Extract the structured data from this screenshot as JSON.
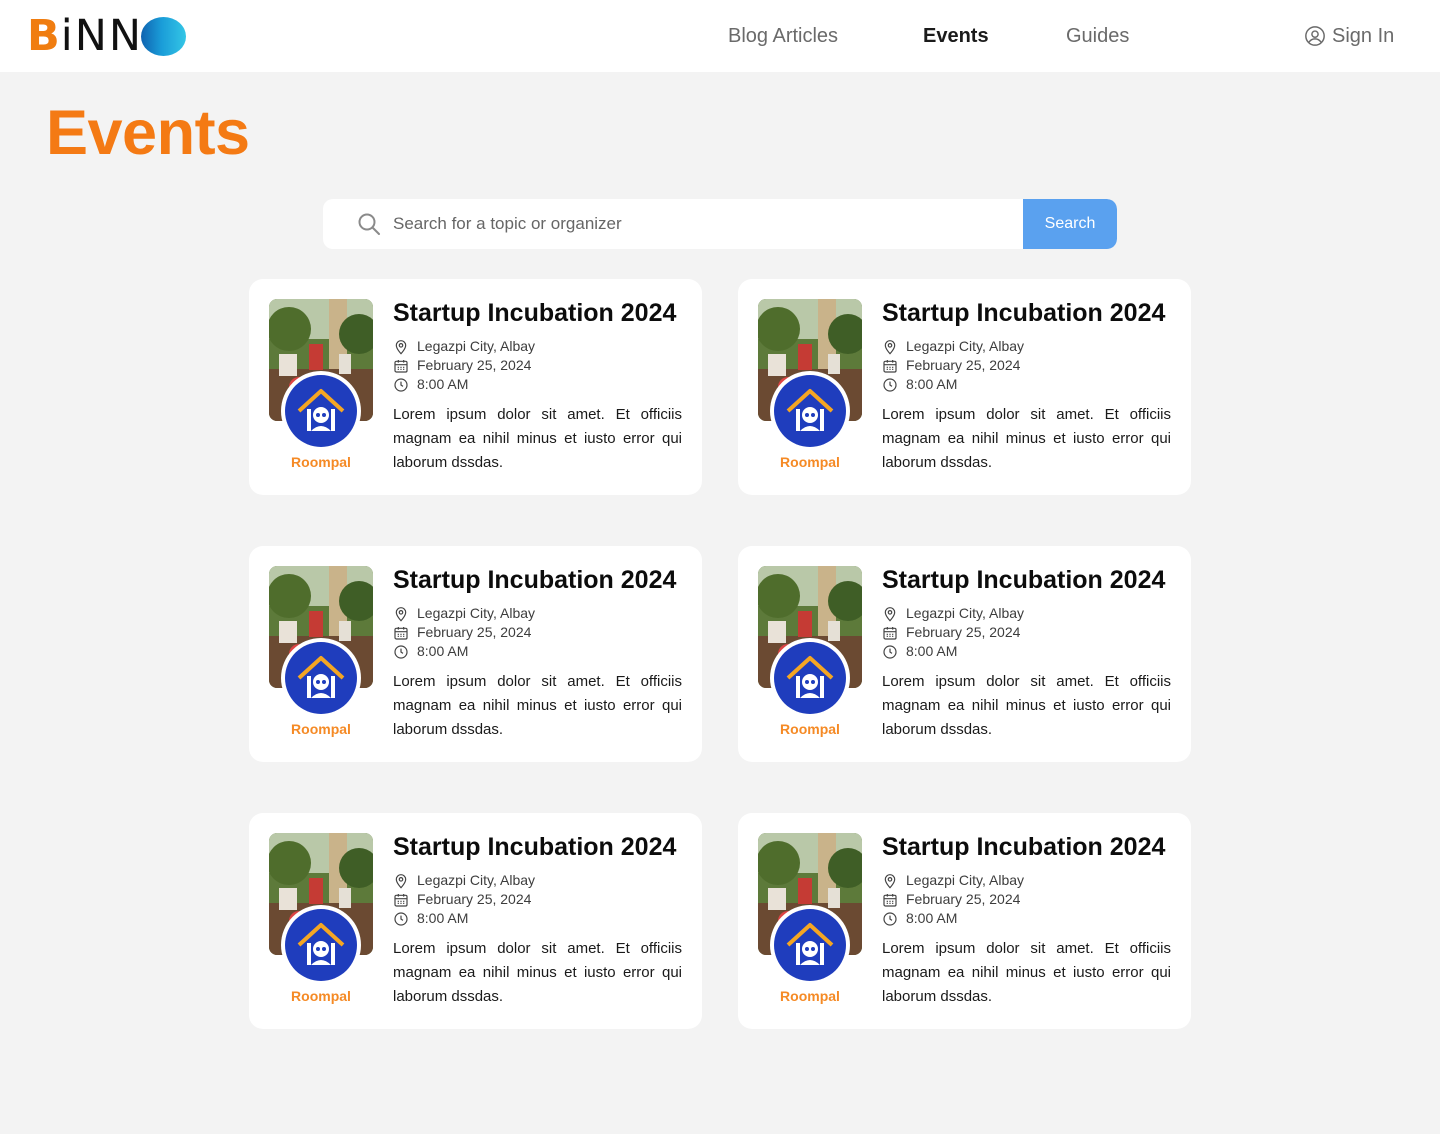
{
  "brand": {
    "logo_letter_b": "B",
    "logo_letters": "iNN",
    "accent_orange": "#f47a14",
    "accent_blue": "#5aa1ef"
  },
  "nav": {
    "items": [
      {
        "label": "Blog Articles",
        "active": false
      },
      {
        "label": "Events",
        "active": true
      },
      {
        "label": "Guides",
        "active": false
      }
    ],
    "sign_in_label": "Sign In",
    "sign_in_icon": "user-circle-icon"
  },
  "page": {
    "title": "Events"
  },
  "search": {
    "placeholder": "Search for a topic or organizer",
    "value": "",
    "button_label": "Search",
    "icon": "search-icon"
  },
  "events": [
    {
      "title": "Startup Incubation 2024",
      "location": "Legazpi City, Albay",
      "date": "February 25, 2024",
      "time": "8:00 AM",
      "description": "Lorem ipsum dolor sit amet. Et officiis magnam ea nihil minus et iusto error qui laborum  dssdas.",
      "organizer": "Roompal"
    },
    {
      "title": "Startup Incubation 2024",
      "location": "Legazpi City, Albay",
      "date": "February 25, 2024",
      "time": "8:00 AM",
      "description": "Lorem ipsum dolor sit amet. Et officiis magnam ea nihil minus et iusto error qui laborum  dssdas.",
      "organizer": "Roompal"
    },
    {
      "title": "Startup Incubation 2024",
      "location": "Legazpi City, Albay",
      "date": "February 25, 2024",
      "time": "8:00 AM",
      "description": "Lorem ipsum dolor sit amet. Et officiis magnam ea nihil minus et iusto error qui laborum  dssdas.",
      "organizer": "Roompal"
    },
    {
      "title": "Startup Incubation 2024",
      "location": "Legazpi City, Albay",
      "date": "February 25, 2024",
      "time": "8:00 AM",
      "description": "Lorem ipsum dolor sit amet. Et officiis magnam ea nihil minus et iusto error qui laborum  dssdas.",
      "organizer": "Roompal"
    },
    {
      "title": "Startup Incubation 2024",
      "location": "Legazpi City, Albay",
      "date": "February 25, 2024",
      "time": "8:00 AM",
      "description": "Lorem ipsum dolor sit amet. Et officiis magnam ea nihil minus et iusto error qui laborum  dssdas.",
      "organizer": "Roompal"
    },
    {
      "title": "Startup Incubation 2024",
      "location": "Legazpi City, Albay",
      "date": "February 25, 2024",
      "time": "8:00 AM",
      "description": "Lorem ipsum dolor sit amet. Et officiis magnam ea nihil minus et iusto error qui laborum  dssdas.",
      "organizer": "Roompal"
    }
  ],
  "event_icons": {
    "location": "map-pin-icon",
    "date": "calendar-icon",
    "time": "clock-icon"
  }
}
